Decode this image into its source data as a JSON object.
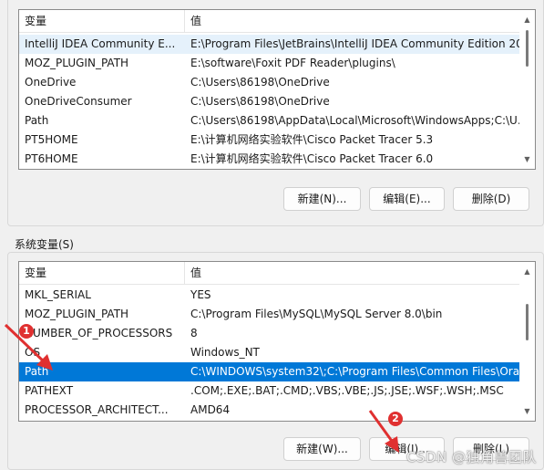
{
  "user_vars": {
    "header": {
      "name": "变量",
      "value": "值"
    },
    "rows": [
      {
        "name": "IntelliJ IDEA Community E...",
        "value": "E:\\Program Files\\JetBrains\\IntelliJ IDEA Community Edition 20..."
      },
      {
        "name": "MOZ_PLUGIN_PATH",
        "value": "E:\\software\\Foxit PDF Reader\\plugins\\"
      },
      {
        "name": "OneDrive",
        "value": "C:\\Users\\86198\\OneDrive"
      },
      {
        "name": "OneDriveConsumer",
        "value": "C:\\Users\\86198\\OneDrive"
      },
      {
        "name": "Path",
        "value": "C:\\Users\\86198\\AppData\\Local\\Microsoft\\WindowsApps;C:\\U..."
      },
      {
        "name": "PT5HOME",
        "value": "E:\\计算机网络实验软件\\Cisco Packet Tracer 5.3"
      },
      {
        "name": "PT6HOME",
        "value": "E:\\计算机网络实验软件\\Cisco Packet Tracer 6.0"
      }
    ],
    "buttons": {
      "new": "新建(N)...",
      "edit": "编辑(E)...",
      "delete": "删除(D)"
    }
  },
  "system_vars": {
    "group_label": "系统变量(S)",
    "header": {
      "name": "变量",
      "value": "值"
    },
    "rows": [
      {
        "name": "MKL_SERIAL",
        "value": "YES"
      },
      {
        "name": "MOZ_PLUGIN_PATH",
        "value": "C:\\Program Files\\MySQL\\MySQL Server 8.0\\bin"
      },
      {
        "name": "NUMBER_OF_PROCESSORS",
        "value": "8"
      },
      {
        "name": "OS",
        "value": "Windows_NT"
      },
      {
        "name": "Path",
        "value": "C:\\WINDOWS\\system32\\;C:\\Program Files\\Common Files\\Ora..."
      },
      {
        "name": "PATHEXT",
        "value": ".COM;.EXE;.BAT;.CMD;.VBS;.VBE;.JS;.JSE;.WSF;.WSH;.MSC"
      },
      {
        "name": "PROCESSOR_ARCHITECT...",
        "value": "AMD64"
      }
    ],
    "buttons": {
      "new": "新建(W)...",
      "edit": "编辑(I)...",
      "delete": "删除(L)"
    }
  },
  "annotations": {
    "marker1": "1",
    "marker2": "2",
    "color": "#e03030"
  },
  "watermark": "CSDN @独角兽团队",
  "colors": {
    "selection": "#0078d7",
    "hover": "#e5f1fb"
  }
}
